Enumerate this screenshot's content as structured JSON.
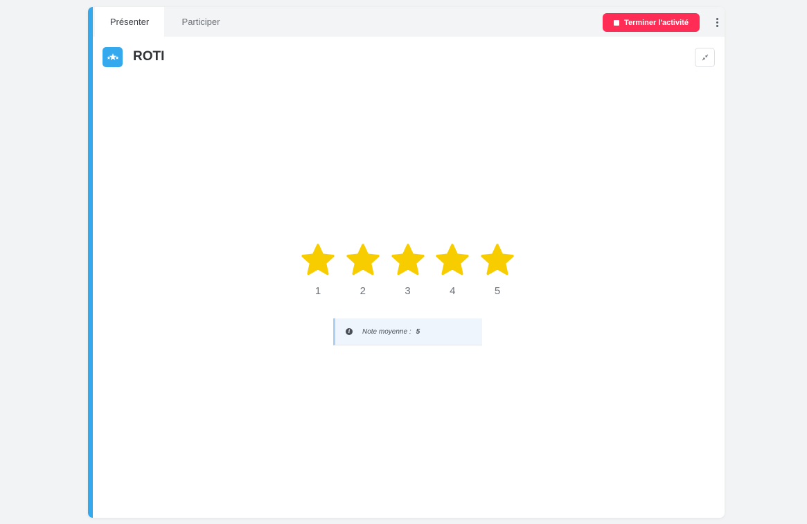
{
  "tabs": [
    {
      "label": "Présenter",
      "active": true
    },
    {
      "label": "Participer",
      "active": false
    }
  ],
  "header": {
    "end_button_label": "Terminer l'activité",
    "end_button_color": "#ff2d55",
    "menu_icon": "more-vertical-icon"
  },
  "activity": {
    "title": "ROTI",
    "icon": "stars-icon",
    "icon_color": "#35a9ee",
    "collapse_icon": "collapse-icon"
  },
  "rating": {
    "max": 5,
    "star_color": "#f7cd00",
    "stars": [
      {
        "label": "1"
      },
      {
        "label": "2"
      },
      {
        "label": "3"
      },
      {
        "label": "4"
      },
      {
        "label": "5"
      }
    ]
  },
  "summary": {
    "label": "Note moyenne :",
    "value": "5",
    "icon": "info-icon"
  },
  "colors": {
    "accent": "#35a9ee",
    "background": "#f2f3f4"
  }
}
